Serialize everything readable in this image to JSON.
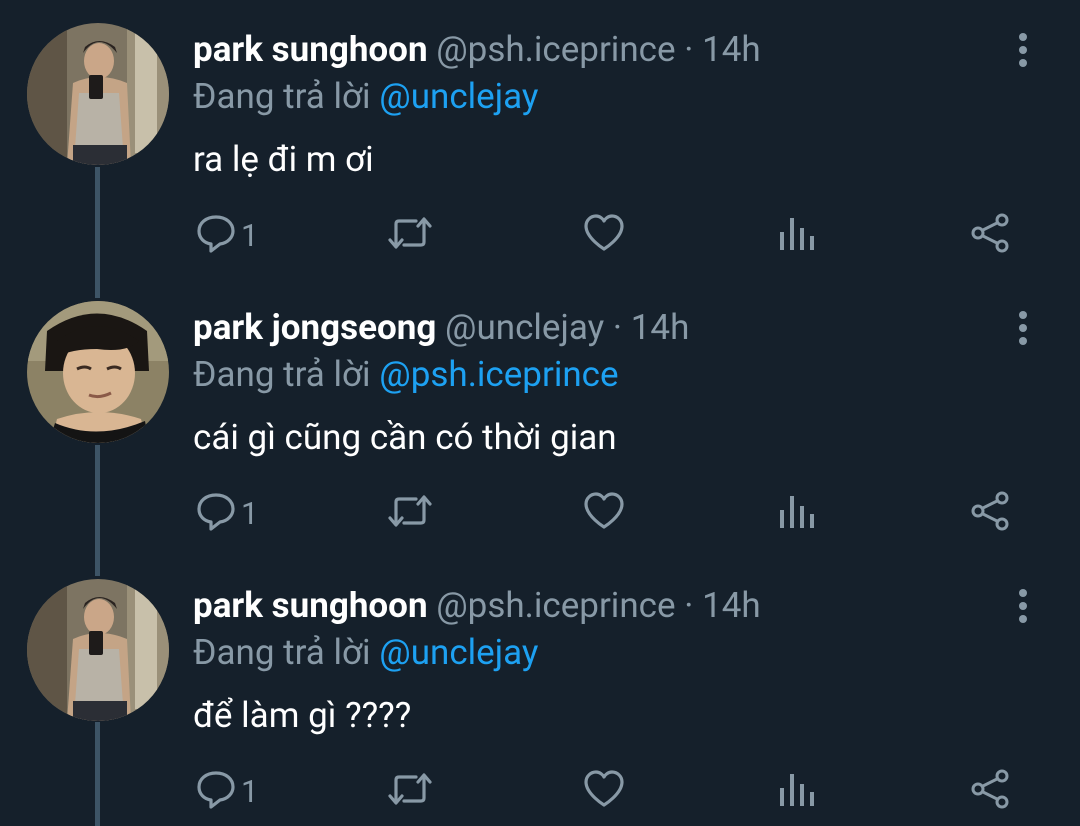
{
  "replies": [
    {
      "avatar": "avatar-photo",
      "name": "park sunghoon",
      "handle": "@psh.iceprince",
      "separator": "·",
      "time": "14h",
      "reply_prefix": "Đang trả lời",
      "reply_to": "@unclejay",
      "text": "ra lẹ đi m ơi",
      "reply_count": "1"
    },
    {
      "avatar": "avatar-photo",
      "name": "park jongseong",
      "handle": "@unclejay",
      "separator": "·",
      "time": "14h",
      "reply_prefix": "Đang trả lời",
      "reply_to": "@psh.iceprince",
      "text": "cái gì cũng cần có thời gian",
      "reply_count": "1"
    },
    {
      "avatar": "avatar-photo",
      "name": "park sunghoon",
      "handle": "@psh.iceprince",
      "separator": "·",
      "time": "14h",
      "reply_prefix": "Đang trả lời",
      "reply_to": "@unclejay",
      "text": "để làm gì ????",
      "reply_count": "1"
    }
  ],
  "icons": {
    "reply": "reply-icon",
    "retweet": "retweet-icon",
    "like": "heart-icon",
    "analytics": "analytics-icon",
    "share": "share-icon",
    "more": "more-options-icon"
  },
  "colors": {
    "background": "#15202b",
    "text_primary": "#ffffff",
    "text_secondary": "#8899a6",
    "link": "#1da1f2",
    "thread_line": "#3d5466"
  }
}
